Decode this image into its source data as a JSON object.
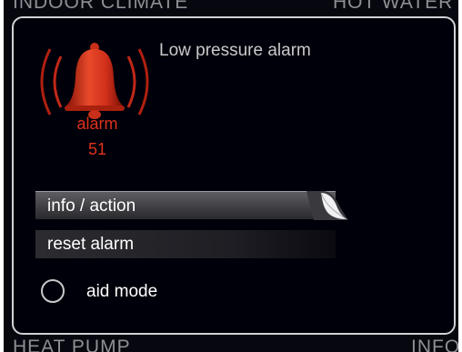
{
  "background": {
    "top_left_label": "INDOOR CLIMATE",
    "top_right_label": "HOT WATER",
    "bottom_left_label": "HEAT PUMP",
    "bottom_right_label": "INFO"
  },
  "dialog": {
    "title": "Low pressure alarm",
    "alarm_icon": "bell-icon",
    "alarm_label": "alarm",
    "alarm_number": "51",
    "menu": [
      {
        "label": "info / action",
        "selected": true
      },
      {
        "label": "reset alarm",
        "selected": false
      }
    ],
    "aid_mode": {
      "label": "aid mode",
      "checked": false
    }
  },
  "colors": {
    "alarm_red": "#e0321c",
    "background": "#00000a",
    "text": "#ffffff",
    "title_text": "#c9c9cc"
  }
}
